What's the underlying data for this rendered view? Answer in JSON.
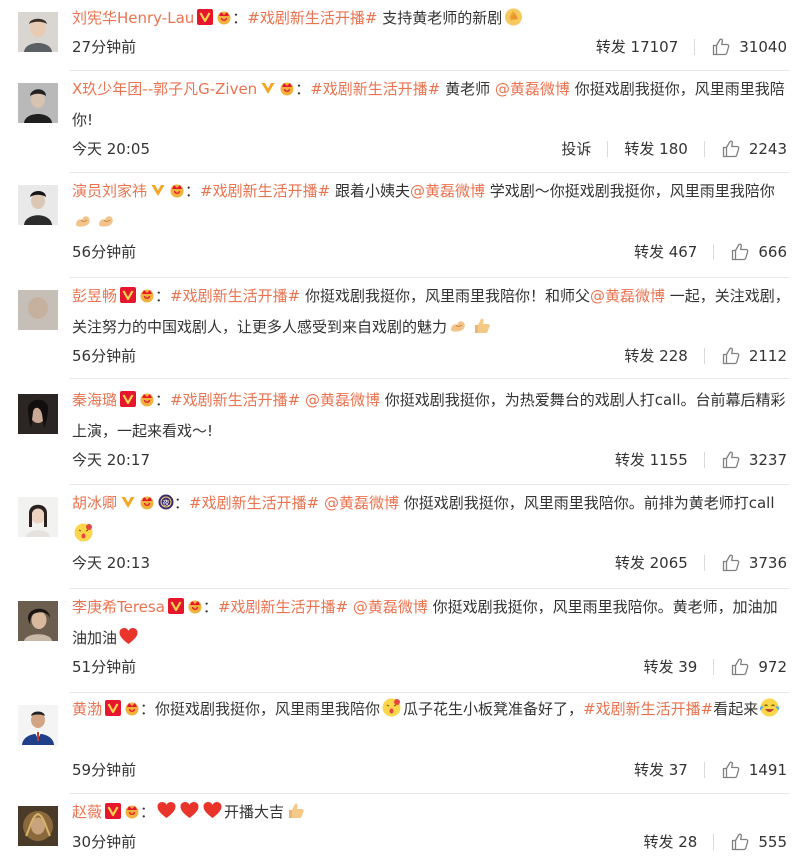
{
  "colors": {
    "accent": "#eb7350",
    "text": "#333333",
    "verified_badge": "#e6162d",
    "separator": "#e6e6e6"
  },
  "comments": [
    {
      "user": "刘宪华Henry-Lau",
      "topic": "#戏剧新生活开播#",
      "text": " 支持黄老师的新剧",
      "time": "27分钟前",
      "repost_label": "转发 17107",
      "likes": "31040"
    },
    {
      "user": "X玖少年团--郭子凡G-Ziven",
      "topic": "#戏剧新生活开播#",
      "text_before": " 黄老师 ",
      "mention": "@黄磊微博",
      "text": " 你挺戏剧我挺你，风里雨里我陪你!",
      "time": "今天 20:05",
      "report_label": "投诉",
      "repost_label": "转发 180",
      "likes": "2243"
    },
    {
      "user": "演员刘家祎",
      "topic": "#戏剧新生活开播#",
      "text_before": " 跟着小姨夫",
      "mention": "@黄磊微博",
      "text": " 学戏剧～你挺戏剧我挺你，风里雨里我陪你",
      "time": "56分钟前",
      "repost_label": "转发 467",
      "likes": "666"
    },
    {
      "user": "彭昱畅",
      "topic": "#戏剧新生活开播#",
      "text_before": " 你挺戏剧我挺你，风里雨里我陪你！和师父",
      "mention": "@黄磊微博",
      "text": " 一起，关注戏剧，关注努力的中国戏剧人，让更多人感受到来自戏剧的魅力",
      "time": "56分钟前",
      "repost_label": "转发 228",
      "likes": "2112"
    },
    {
      "user": "秦海璐",
      "topic": "#戏剧新生活开播#",
      "text_before": " ",
      "mention": "@黄磊微博",
      "text": " 你挺戏剧我挺你，为热爱舞台的戏剧人打call。台前幕后精彩上演，一起来看戏～!",
      "time": "今天 20:17",
      "repost_label": "转发 1155",
      "likes": "3237"
    },
    {
      "user": "胡冰卿",
      "topic": "#戏剧新生活开播#",
      "text_before": " ",
      "mention": "@黄磊微博",
      "text": " 你挺戏剧我挺你，风里雨里我陪你。前排为黄老师打call",
      "time": "今天 20:13",
      "repost_label": "转发 2065",
      "likes": "3736"
    },
    {
      "user": "李庚希Teresa",
      "topic": "#戏剧新生活开播#",
      "text_before": " ",
      "mention": "@黄磊微博",
      "text": " 你挺戏剧我挺你，风里雨里我陪你。黄老师，加油加油加油",
      "time": "51分钟前",
      "repost_label": "转发 39",
      "likes": "972"
    },
    {
      "user": "黄渤",
      "text_before": "你挺戏剧我挺你，风里雨里我陪你",
      "text_mid": "瓜子花生小板凳准备好了，",
      "topic": "#戏剧新生活开播#",
      "text": "看起来",
      "time": "59分钟前",
      "repost_label": "转发 37",
      "likes": "1491"
    },
    {
      "user": "赵薇",
      "text": "开播大吉",
      "time": "30分钟前",
      "repost_label": "转发 28",
      "likes": "555"
    }
  ]
}
